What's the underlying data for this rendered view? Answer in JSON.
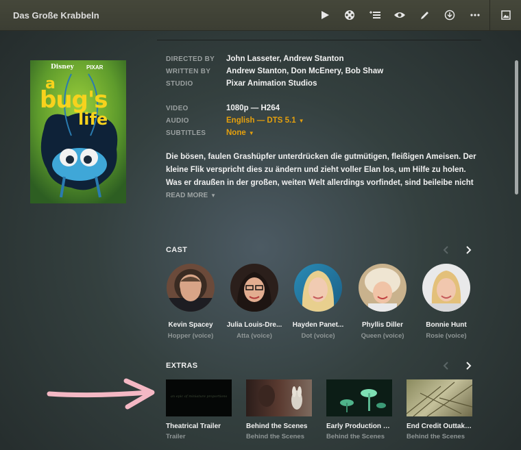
{
  "header": {
    "title": "Das Große Krabbeln",
    "icons": [
      "play-icon",
      "film-reel-icon",
      "add-to-playlist-icon",
      "eye-icon",
      "pencil-icon",
      "download-icon",
      "more-icon",
      "image-icon"
    ]
  },
  "poster": {
    "brand_left": "Disney",
    "brand_right": "PIXAR",
    "logo_line1": "a",
    "logo_line2": "bug's",
    "logo_line3": "life"
  },
  "details": {
    "directed_by_label": "DIRECTED BY",
    "directed_by": "John Lasseter, Andrew Stanton",
    "written_by_label": "WRITTEN BY",
    "written_by": "Andrew Stanton, Don McEnery, Bob Shaw",
    "studio_label": "STUDIO",
    "studio": "Pixar Animation Studios",
    "video_label": "VIDEO",
    "video": "1080p — H264",
    "audio_label": "AUDIO",
    "audio": "English — DTS 5.1",
    "subtitles_label": "SUBTITLES",
    "subtitles": "None"
  },
  "summary": "Die bösen, faulen Grashüpfer unterdrücken die gutmütigen, fleißigen Ameisen. Der kleine Flik verspricht dies zu ändern und zieht voller Elan los, um Hilfe zu holen. Was er draußen in der großen, weiten Welt allerdings vorfindet, sind beileibe nicht die",
  "read_more": "READ MORE",
  "cast": {
    "title": "CAST",
    "items": [
      {
        "name": "Kevin Spacey",
        "role": "Hopper (voice)"
      },
      {
        "name": "Julia Louis-Dre...",
        "role": "Atta (voice)"
      },
      {
        "name": "Hayden Panet...",
        "role": "Dot (voice)"
      },
      {
        "name": "Phyllis Diller",
        "role": "Queen (voice)"
      },
      {
        "name": "Bonnie Hunt",
        "role": "Rosie (voice)"
      }
    ]
  },
  "extras": {
    "title": "EXTRAS",
    "items": [
      {
        "name": "Theatrical Trailer",
        "type": "Trailer",
        "thumb_text": "an epic of miniature proportions"
      },
      {
        "name": "Behind the Scenes",
        "type": "Behind the Scenes"
      },
      {
        "name": "Early Production Te...",
        "type": "Behind the Scenes"
      },
      {
        "name": "End Credit Outtake...",
        "type": "Behind the Scenes"
      }
    ]
  },
  "colors": {
    "accent": "#e5a00d",
    "annotation_arrow": "#f4b8c4"
  }
}
